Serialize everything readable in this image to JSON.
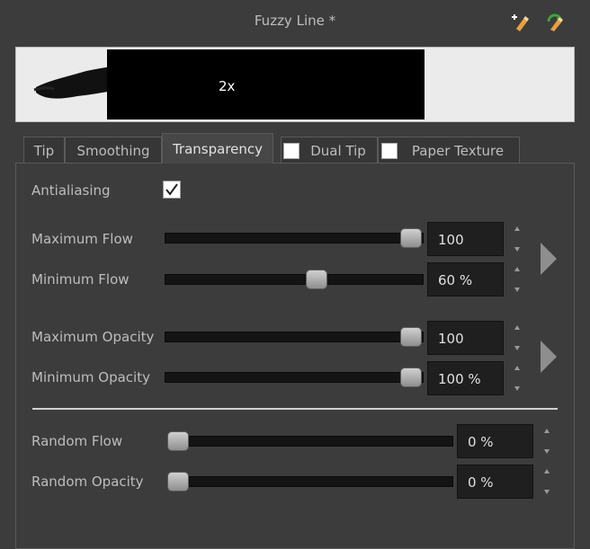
{
  "window": {
    "title": "Fuzzy Line *"
  },
  "header_icons": [
    "new-brush-icon",
    "reset-brush-icon"
  ],
  "preview": {
    "zoom_label": "2x"
  },
  "tabs": [
    {
      "label": "Tip",
      "active": false,
      "has_checkbox": false
    },
    {
      "label": "Smoothing",
      "active": false,
      "has_checkbox": false
    },
    {
      "label": "Transparency",
      "active": true,
      "has_checkbox": false
    },
    {
      "label": "Dual Tip",
      "active": false,
      "has_checkbox": true,
      "checked": false
    },
    {
      "label": "Paper Texture",
      "active": false,
      "has_checkbox": true,
      "checked": false
    }
  ],
  "antialiasing": {
    "label": "Antialiasing",
    "checked": true
  },
  "flow": {
    "max": {
      "label": "Maximum Flow",
      "value": "100",
      "level": 1.0
    },
    "min": {
      "label": "Minimum Flow",
      "value": "60 %",
      "level": 0.6
    }
  },
  "opacity": {
    "max": {
      "label": "Maximum Opacity",
      "value": "100",
      "level": 1.0
    },
    "min": {
      "label": "Minimum Opacity",
      "value": "100 %",
      "level": 1.0
    }
  },
  "random": {
    "flow": {
      "label": "Random Flow",
      "value": "0 %",
      "level": 0.0
    },
    "opacity": {
      "label": "Random Opacity",
      "value": "0 %",
      "level": 0.0
    }
  },
  "colors": {
    "background": "#3c3c3c",
    "track": "#141414",
    "value_box": "#1f1f1f",
    "preview_bg": "#ebebeb"
  }
}
